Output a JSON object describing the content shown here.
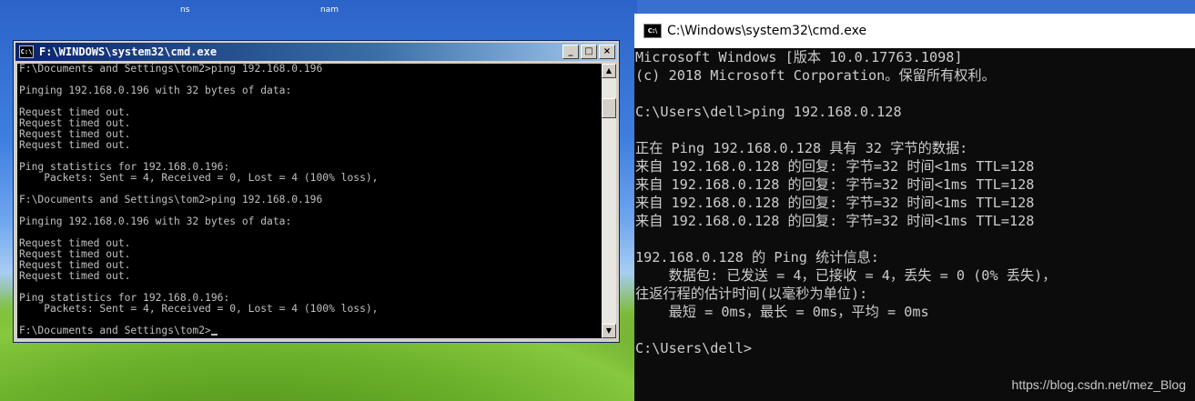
{
  "desktop": {
    "labels": [
      "ns",
      "nam"
    ]
  },
  "xp_window": {
    "title": "F:\\WINDOWS\\system32\\cmd.exe",
    "icon_text": "C:\\",
    "controls": [
      "_",
      "□",
      "×"
    ],
    "lines": [
      "F:\\Documents and Settings\\tom2>ping 192.168.0.196",
      "",
      "Pinging 192.168.0.196 with 32 bytes of data:",
      "",
      "Request timed out.",
      "Request timed out.",
      "Request timed out.",
      "Request timed out.",
      "",
      "Ping statistics for 192.168.0.196:",
      "    Packets: Sent = 4, Received = 0, Lost = 4 (100% loss),",
      "",
      "F:\\Documents and Settings\\tom2>ping 192.168.0.196",
      "",
      "Pinging 192.168.0.196 with 32 bytes of data:",
      "",
      "Request timed out.",
      "Request timed out.",
      "Request timed out.",
      "Request timed out.",
      "",
      "Ping statistics for 192.168.0.196:",
      "    Packets: Sent = 4, Received = 0, Lost = 4 (100% loss),",
      "",
      "F:\\Documents and Settings\\tom2>"
    ]
  },
  "w10_window": {
    "title": "C:\\Windows\\system32\\cmd.exe",
    "icon_text": "C:\\",
    "lines": [
      "Microsoft Windows [版本 10.0.17763.1098]",
      "(c) 2018 Microsoft Corporation。保留所有权利。",
      "",
      "C:\\Users\\dell>ping 192.168.0.128",
      "",
      "正在 Ping 192.168.0.128 具有 32 字节的数据:",
      "来自 192.168.0.128 的回复: 字节=32 时间<1ms TTL=128",
      "来自 192.168.0.128 的回复: 字节=32 时间<1ms TTL=128",
      "来自 192.168.0.128 的回复: 字节=32 时间<1ms TTL=128",
      "来自 192.168.0.128 的回复: 字节=32 时间<1ms TTL=128",
      "",
      "192.168.0.128 的 Ping 统计信息:",
      "    数据包: 已发送 = 4，已接收 = 4，丢失 = 0 (0% 丢失)，",
      "往返行程的估计时间(以毫秒为单位):",
      "    最短 = 0ms，最长 = 0ms，平均 = 0ms",
      "",
      "C:\\Users\\dell>"
    ]
  },
  "watermark": "https://blog.csdn.net/mez_Blog"
}
